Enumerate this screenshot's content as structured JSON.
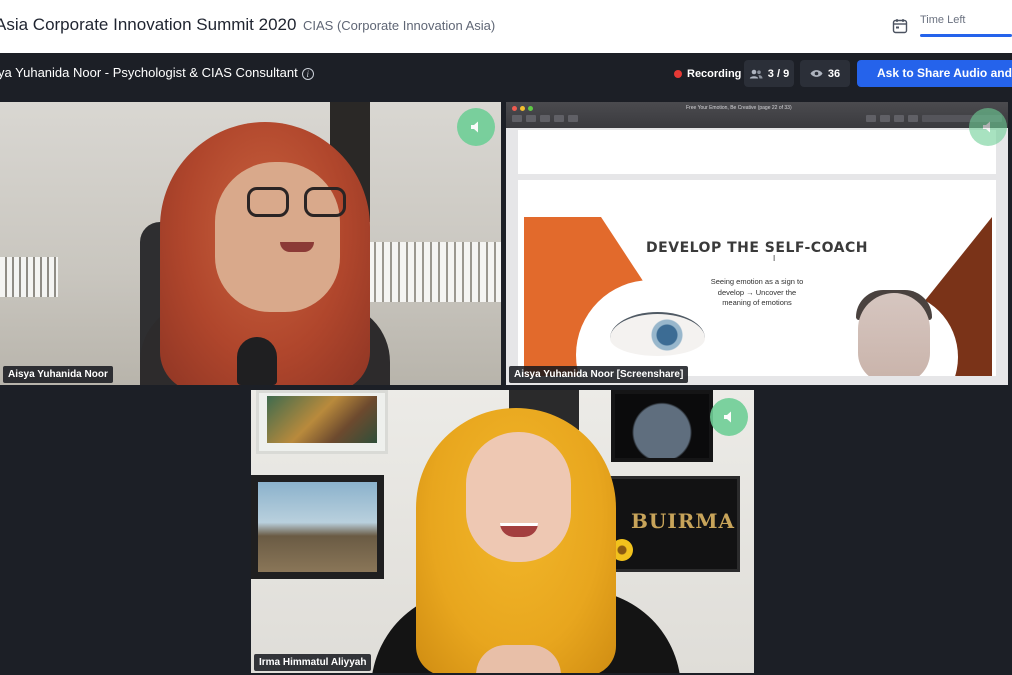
{
  "header": {
    "event_title": "Asia Corporate Innovation Summit 2020",
    "org_name": "CIAS (Corporate Innovation Asia)",
    "time_left_label": "Time Left"
  },
  "session": {
    "speaker_title": "Aisya Yuhanida Noor - Psychologist & CIAS Consultant",
    "recording_label": "Recording",
    "participants_count": "3 / 9",
    "viewers_count": "36",
    "share_button_label": "Ask to Share Audio and Video"
  },
  "tiles": [
    {
      "name": "Aisya Yuhanida Noor"
    },
    {
      "name": "Aisya Yuhanida Noor [Screenshare]"
    },
    {
      "name": "Irma Himmatul Aliyyah"
    }
  ],
  "screenshare": {
    "window_title": "Free Your Emotion, Be Creative (page 22 of 33)",
    "slide_heading": "DEVELOP THE SELF-COACH",
    "slide_text": "Seeing emotion as a sign to develop → Uncover the meaning of emotions",
    "wall_art_text": "BUIRMA"
  },
  "colors": {
    "accent": "#2563eb",
    "recording_dot": "#e53935",
    "speaker_indicator": "#6fcf97",
    "stage_background": "#1c1f26"
  },
  "icons": {
    "calendar": "calendar-icon",
    "info": "info-icon",
    "participants": "people-icon",
    "viewers": "eye-icon",
    "speaking": "speaker-icon"
  }
}
